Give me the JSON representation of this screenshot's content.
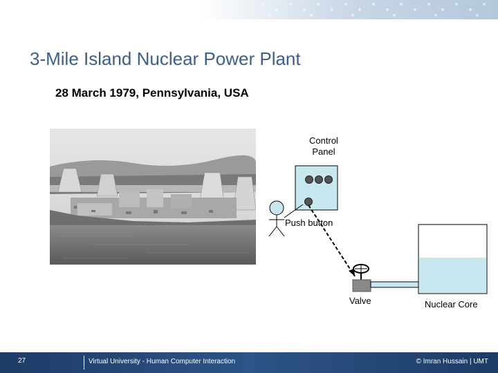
{
  "slide": {
    "title": "3-Mile Island Nuclear Power Plant",
    "subtitle": "28 March 1979, Pennsylvania, USA"
  },
  "diagram": {
    "control_panel_label": "Control Panel",
    "push_button_label": "Push button",
    "valve_label": "Valve",
    "nuclear_core_label": "Nuclear Core",
    "core_water_color": "#c7e8ee",
    "panel_color": "#c7e8ee"
  },
  "footer": {
    "page_number": "27",
    "course": "Virtual University - Human Computer Interaction",
    "copyright": "© Imran Hussain | UMT"
  }
}
